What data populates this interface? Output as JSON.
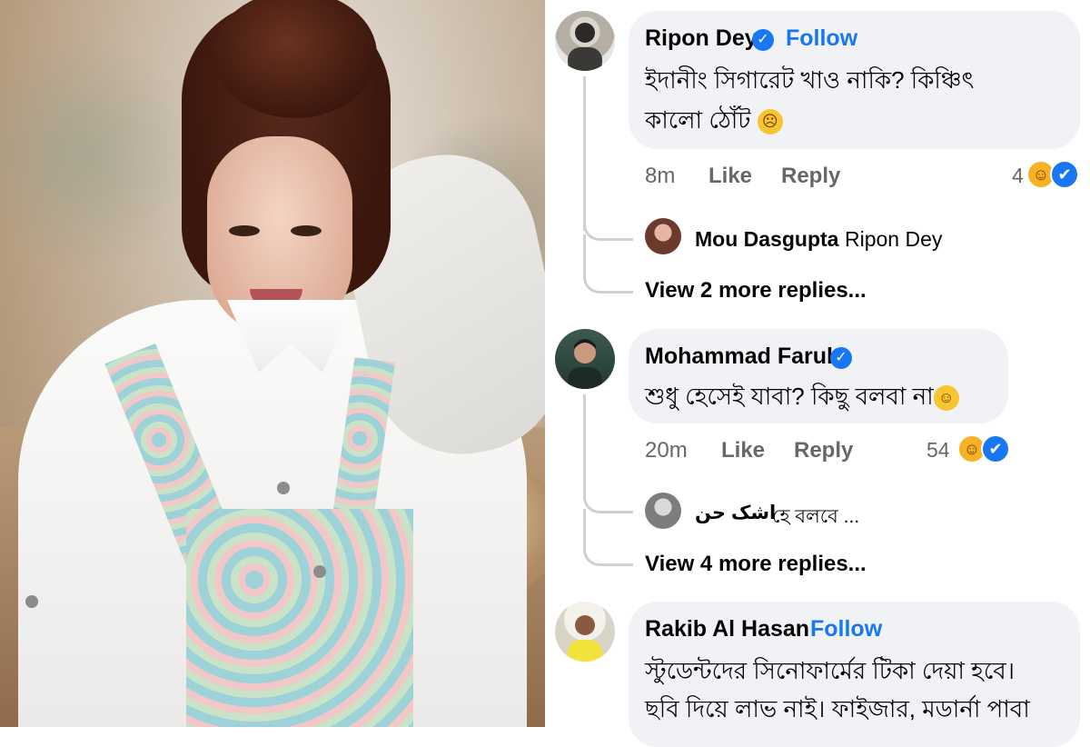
{
  "photo": {
    "alt": ""
  },
  "comments": [
    {
      "author": "Ripon Dey",
      "verified": true,
      "follow_label": "Follow",
      "text_line1": "ইদানীং সিগারেট খাও নাকি? কিঞ্চিৎ",
      "text_line2": "কালো ঠোঁট",
      "emoji": "😞",
      "time": "8m",
      "like_label": "Like",
      "reply_label": "Reply",
      "reaction_count": "4",
      "reactions": [
        "haha-icon",
        "like-icon"
      ],
      "reply_preview": {
        "author": "Mou Dasgupta",
        "text": "Ripon Dey"
      },
      "view_more": "View 2 more replies..."
    },
    {
      "author": "Mohammad Faruk",
      "verified": true,
      "text_line1": "শুধু হেসেই যাবা? কিছু বলবা না",
      "emoji": "😝",
      "time": "20m",
      "like_label": "Like",
      "reply_label": "Reply",
      "reaction_count": "54",
      "reactions": [
        "haha-icon",
        "like-icon"
      ],
      "reply_preview": {
        "author": "اشک حن",
        "text": "হে বলবে ..."
      },
      "view_more": "View 4 more replies..."
    },
    {
      "author": "Rakib Al Hasan",
      "verified": false,
      "follow_label": "Follow",
      "text_line1": "স্টুডেন্টদের সিনোফার্মের টিকা দেয়া হবে।",
      "text_line2": "ছবি দিয়ে লাভ নাই। ফাইজার, মডার্না পাবা"
    }
  ],
  "colors": {
    "bubble": "#f0f2f5",
    "link": "#1877f2",
    "meta": "#65676b",
    "haha": "#f7b125",
    "like": "#1877f2"
  }
}
